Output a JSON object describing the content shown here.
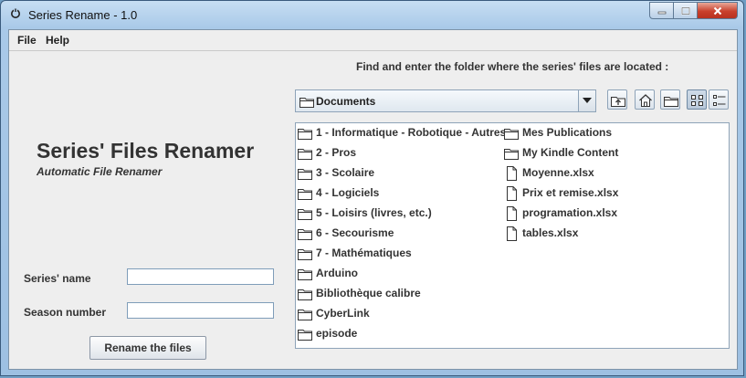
{
  "window": {
    "title": "Series Rename - 1.0"
  },
  "menu": [
    "File",
    "Help"
  ],
  "left": {
    "app_title": "Series' Files Renamer",
    "app_subtitle": "Automatic File Renamer",
    "series_label": "Series' name",
    "series_value": "",
    "season_label": "Season number",
    "season_value": "",
    "rename_button": "Rename the files"
  },
  "chooser": {
    "label": "Find and enter the folder where the series' files are located :",
    "current_folder": "Documents",
    "columns": [
      [
        {
          "name": "1 - Informatique - Robotique - Autres",
          "type": "folder"
        },
        {
          "name": "2 - Pros",
          "type": "folder"
        },
        {
          "name": "3 - Scolaire",
          "type": "folder"
        },
        {
          "name": "4 - Logiciels",
          "type": "folder"
        },
        {
          "name": "5 - Loisirs (livres, etc.)",
          "type": "folder"
        },
        {
          "name": "6 - Secourisme",
          "type": "folder"
        },
        {
          "name": "7 - Mathématiques",
          "type": "folder"
        },
        {
          "name": "Arduino",
          "type": "folder"
        },
        {
          "name": "Bibliothèque calibre",
          "type": "folder"
        },
        {
          "name": "CyberLink",
          "type": "folder"
        },
        {
          "name": "episode",
          "type": "folder"
        }
      ],
      [
        {
          "name": "Mes Publications",
          "type": "folder"
        },
        {
          "name": "My Kindle Content",
          "type": "folder"
        },
        {
          "name": "Moyenne.xlsx",
          "type": "file"
        },
        {
          "name": "Prix et remise.xlsx",
          "type": "file"
        },
        {
          "name": "programation.xlsx",
          "type": "file"
        },
        {
          "name": "tables.xlsx",
          "type": "file"
        }
      ]
    ]
  }
}
